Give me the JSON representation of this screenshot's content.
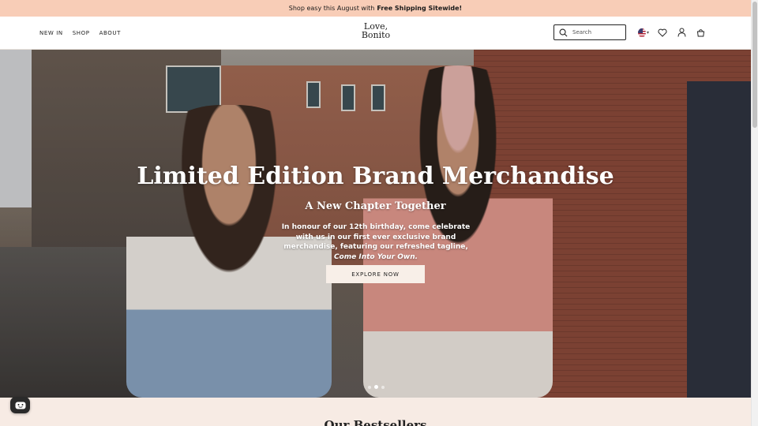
{
  "announcement": {
    "prefix": "Shop easy this August with",
    "highlight": "Free Shipping Sitewide!"
  },
  "header": {
    "nav": [
      "NEW IN",
      "SHOP",
      "ABOUT"
    ],
    "logo": {
      "line1": "Love,",
      "line2": "Bonito"
    },
    "search": {
      "placeholder": "Search"
    },
    "icons": [
      "search-icon",
      "us-flag-icon",
      "heart-icon",
      "user-icon",
      "bag-icon"
    ]
  },
  "hero": {
    "title": "Limited Edition Brand Merchandise",
    "subtitle": "A New Chapter Together",
    "body": "In honour of our 12th birthday, come celebrate with us in our first ever exclusive brand merchandise, featuring our refreshed tagline,",
    "tagline": "Come Into Your Own.",
    "cta": "EXPLORE NOW",
    "slides_total": 3,
    "slide_active": 2
  },
  "section": {
    "title": "Our Bestsellers"
  },
  "colors": {
    "announcement_bg": "#f8cdb7",
    "cta_bg": "#f8efe8",
    "section_bg": "#f7ebe4"
  }
}
